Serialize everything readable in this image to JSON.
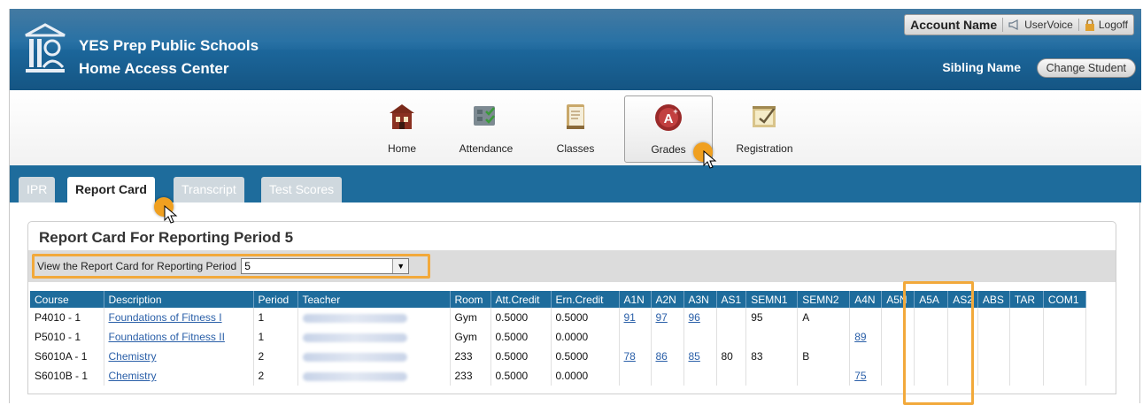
{
  "header": {
    "school": "YES Prep Public Schools",
    "app": "Home Access Center",
    "account_name": "Account Name",
    "uservoice": "UserVoice",
    "logoff": "Logoff",
    "sibling_name": "Sibling Name",
    "change_student": "Change Student"
  },
  "nav": [
    {
      "label": "Home",
      "icon": "home-icon"
    },
    {
      "label": "Attendance",
      "icon": "attendance-icon"
    },
    {
      "label": "Classes",
      "icon": "classes-icon"
    },
    {
      "label": "Grades",
      "icon": "grades-icon"
    },
    {
      "label": "Registration",
      "icon": "registration-icon"
    }
  ],
  "tabs": [
    {
      "label": "IPR"
    },
    {
      "label": "Report Card"
    },
    {
      "label": "Transcript"
    },
    {
      "label": "Test Scores"
    }
  ],
  "report": {
    "title": "Report Card For Reporting Period 5",
    "filter_label": "View the Report Card for Reporting Period",
    "period_value": "5"
  },
  "table": {
    "headers": [
      "Course",
      "Description",
      "Period",
      "Teacher",
      "Room",
      "Att.Credit",
      "Ern.Credit",
      "A1N",
      "A2N",
      "A3N",
      "AS1",
      "SEMN1",
      "SEMN2",
      "A4N",
      "A5N",
      "A5A",
      "AS2",
      "ABS",
      "TAR",
      "COM1"
    ],
    "rows": [
      [
        "P4010 - 1",
        "Foundations of Fitness I",
        "1",
        "",
        "Gym",
        "0.5000",
        "0.5000",
        "91",
        "97",
        "96",
        "",
        "95",
        "A",
        "",
        "",
        "",
        "",
        "",
        "",
        ""
      ],
      [
        "P5010 - 1",
        "Foundations of Fitness II",
        "1",
        "",
        "Gym",
        "0.5000",
        "0.0000",
        "",
        "",
        "",
        "",
        "",
        "",
        "89",
        "",
        "",
        "",
        "",
        "",
        ""
      ],
      [
        "S6010A - 1",
        "Chemistry",
        "2",
        "",
        "233",
        "0.5000",
        "0.5000",
        "78",
        "86",
        "85",
        "80",
        "83",
        "B",
        "",
        "",
        "",
        "",
        "",
        "",
        ""
      ],
      [
        "S6010B - 1",
        "Chemistry",
        "2",
        "",
        "233",
        "0.5000",
        "0.0000",
        "",
        "",
        "",
        "",
        "",
        "",
        "75",
        "",
        "",
        "",
        "",
        "",
        ""
      ]
    ]
  },
  "colors": {
    "header": "#1d6aa0",
    "tabbar": "#1e6c9c",
    "highlight": "#f2a93b",
    "link": "#2a5fa8"
  }
}
